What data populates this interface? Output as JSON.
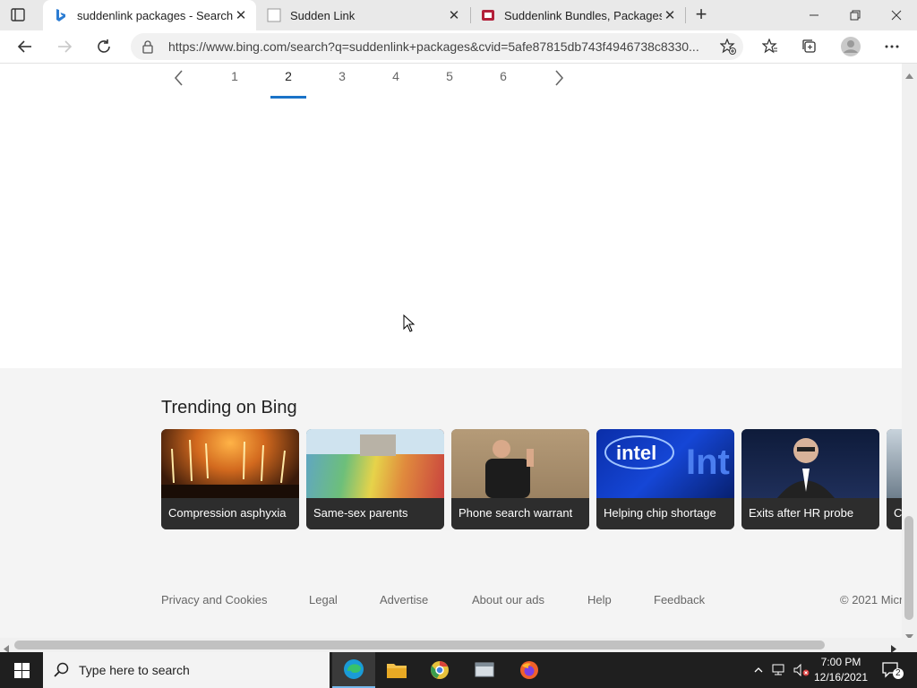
{
  "browser": {
    "tabs": [
      {
        "title": "suddenlink packages - Search",
        "active": true,
        "icon": "bing-icon"
      },
      {
        "title": "Sudden Link",
        "active": false,
        "icon": "blank-page-icon"
      },
      {
        "title": "Suddenlink Bundles, Packages and",
        "active": false,
        "icon": "site-favicon"
      }
    ],
    "url": "https://www.bing.com/search?q=suddenlink+packages&cvid=5afe87815db743f4946738c8330..."
  },
  "pagination": {
    "pages": [
      "1",
      "2",
      "3",
      "4",
      "5",
      "6"
    ],
    "current": "2"
  },
  "trending": {
    "title": "Trending on Bing",
    "cards": [
      {
        "caption": "Compression asphyxia"
      },
      {
        "caption": "Same-sex parents"
      },
      {
        "caption": "Phone search warrant"
      },
      {
        "caption": "Helping chip shortage"
      },
      {
        "caption": "Exits after HR probe"
      },
      {
        "caption": "C"
      }
    ]
  },
  "footer": {
    "links": [
      "Privacy and Cookies",
      "Legal",
      "Advertise",
      "About our ads",
      "Help",
      "Feedback"
    ],
    "copyright": "© 2021 Micr"
  },
  "taskbar": {
    "search_placeholder": "Type here to search",
    "time": "7:00 PM",
    "date": "12/16/2021",
    "notification_count": "2"
  },
  "colors": {
    "accent": "#1a73c8",
    "taskbar": "#1f1f1f",
    "trending_bg": "#f4f4f4"
  }
}
